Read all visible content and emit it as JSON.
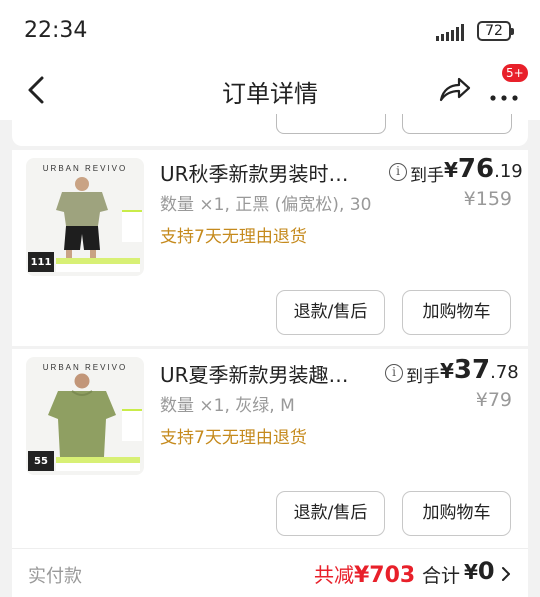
{
  "status_bar": {
    "time": "22:34",
    "battery": "72"
  },
  "nav": {
    "title": "订单详情",
    "badge": "5+"
  },
  "items": [
    {
      "brand": "URBAN REVIVO",
      "img_price": "111",
      "title": "UR秋季新款男装时…",
      "spec": "数量 ×1, 正黑 (偏宽松), 30",
      "policy": "支持7天无理由退货",
      "price_label": "到手",
      "price_currency": "¥",
      "price_int": "76",
      "price_dec": ".19",
      "orig_price": "¥159",
      "btn_refund": "退款/售后",
      "btn_cart": "加购物车"
    },
    {
      "brand": "URBAN REVIVO",
      "img_price": "55",
      "title": "UR夏季新款男装趣…",
      "spec": "数量 ×1, 灰绿, M",
      "policy": "支持7天无理由退货",
      "price_label": "到手",
      "price_currency": "¥",
      "price_int": "37",
      "price_dec": ".78",
      "orig_price": "¥79",
      "btn_refund": "退款/售后",
      "btn_cart": "加购物车"
    }
  ],
  "payment": {
    "label": "实付款",
    "discount_prefix": "共减",
    "discount_value": "¥703",
    "total_label": "合计",
    "total_currency": "¥",
    "total_value": "0"
  },
  "colors": {
    "accent_red": "#e8202a",
    "policy_gold": "#c58a1d"
  }
}
